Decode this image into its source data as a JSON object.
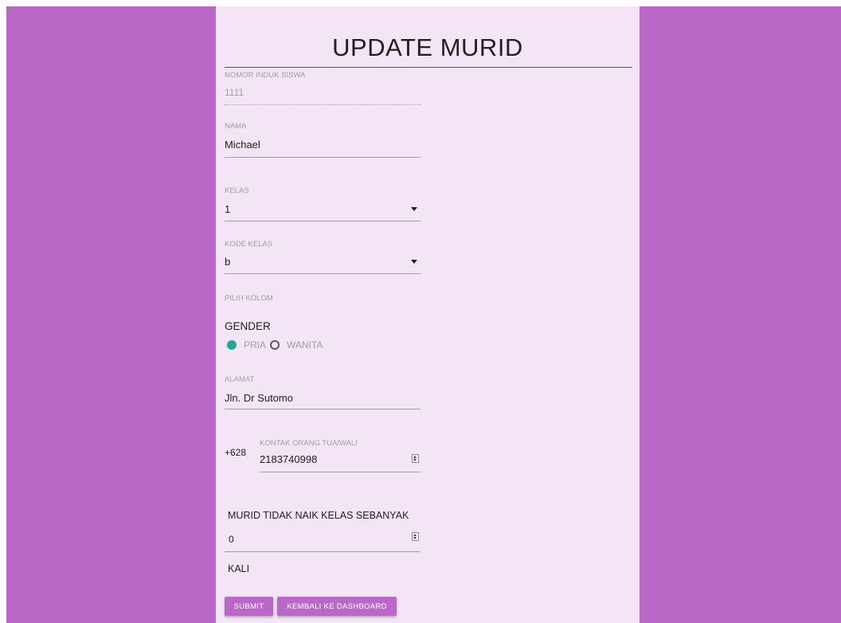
{
  "page": {
    "title": "UPDATE MURID"
  },
  "form": {
    "nis": {
      "label": "NOMOR INDUK SISWA",
      "value": "1111"
    },
    "nama": {
      "label": "NAMA",
      "value": "Michael"
    },
    "kelas": {
      "label": "KELAS",
      "value": "1"
    },
    "kode_kelas": {
      "label": "KODE KELAS",
      "value": "b"
    },
    "pilih_kolom": {
      "label": "PILIH KOLOM"
    },
    "gender": {
      "label": "GENDER",
      "options": [
        {
          "label": "PRIA",
          "checked": true
        },
        {
          "label": "WANITA",
          "checked": false
        }
      ]
    },
    "alamat": {
      "label": "ALAMAT",
      "value": "Jln. Dr Sutomo"
    },
    "kontak": {
      "prefix": "+628",
      "label": "KONTAK ORANG TUA/WALI",
      "value": "2183740998"
    },
    "tidak_naik": {
      "label": "MURID TIDAK NAIK KELAS SEBANYAK",
      "value": "0",
      "suffix": "KALI"
    }
  },
  "buttons": {
    "submit": "SUBMIT",
    "dashboard": "KEMBALI KE DASHBOARD"
  },
  "colors": {
    "backdrop": "#ba68c8",
    "card": "#f3e5f5",
    "accent_radio": "#26a69a",
    "button": "#ba68c8"
  }
}
